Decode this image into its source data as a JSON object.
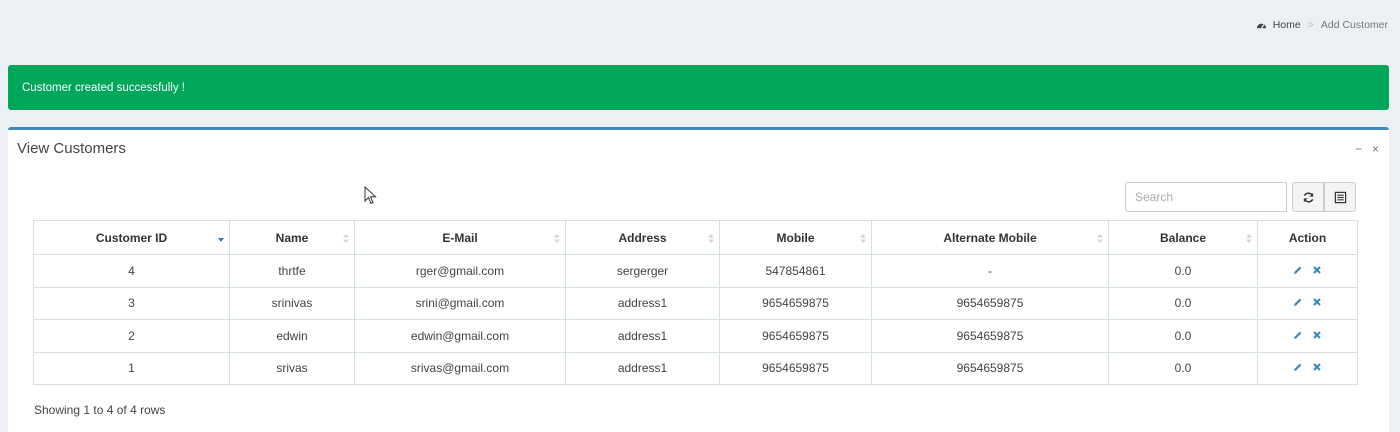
{
  "breadcrumb": {
    "home": "Home",
    "separator": ">",
    "current": "Add Customer"
  },
  "alert": {
    "message": "Customer created successfully !"
  },
  "box": {
    "title": "View Customers",
    "minimize": "−",
    "close": "×"
  },
  "toolbar": {
    "search_placeholder": "Search"
  },
  "table": {
    "columns": [
      "Customer ID",
      "Name",
      "E-Mail",
      "Address",
      "Mobile",
      "Alternate Mobile",
      "Balance",
      "Action"
    ],
    "rows": [
      [
        "4",
        "thrtfe",
        "rger@gmail.com",
        "sergerger",
        "547854861",
        "-",
        "0.0"
      ],
      [
        "3",
        "srinivas",
        "srini@gmail.com",
        "address1",
        "9654659875",
        "9654659875",
        "0.0"
      ],
      [
        "2",
        "edwin",
        "edwin@gmail.com",
        "address1",
        "9654659875",
        "9654659875",
        "0.0"
      ],
      [
        "1",
        "srivas",
        "srivas@gmail.com",
        "address1",
        "9654659875",
        "9654659875",
        "0.0"
      ]
    ]
  },
  "footer": {
    "info": "Showing 1 to 4 of 4 rows"
  },
  "colors": {
    "success": "#00a65a",
    "accent": "#3c8dbc",
    "action_icon": "#3c8dbc"
  }
}
